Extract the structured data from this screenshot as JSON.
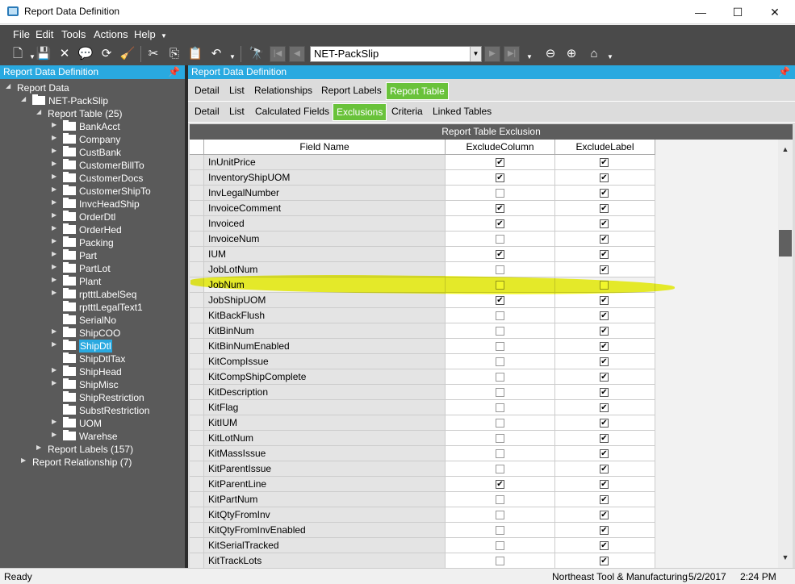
{
  "window": {
    "title": "Report Data Definition",
    "controls": [
      "—",
      "☐",
      "✕"
    ]
  },
  "menu": [
    "File",
    "Edit",
    "Tools",
    "Actions",
    "Help"
  ],
  "toolbar": {
    "record": "NET-PackSlip"
  },
  "left_panel": {
    "title": "Report Data Definition",
    "tree": [
      {
        "label": "Report Data",
        "level": 0,
        "twist": "open",
        "folder": false
      },
      {
        "label": "NET-PackSlip",
        "level": 1,
        "twist": "open",
        "folder": true
      },
      {
        "label": "Report Table (25)",
        "level": 2,
        "twist": "open",
        "folder": false
      },
      {
        "label": "BankAcct",
        "level": 3,
        "twist": "closed",
        "folder": true
      },
      {
        "label": "Company",
        "level": 3,
        "twist": "closed",
        "folder": true
      },
      {
        "label": "CustBank",
        "level": 3,
        "twist": "closed",
        "folder": true
      },
      {
        "label": "CustomerBillTo",
        "level": 3,
        "twist": "closed",
        "folder": true
      },
      {
        "label": "CustomerDocs",
        "level": 3,
        "twist": "closed",
        "folder": true
      },
      {
        "label": "CustomerShipTo",
        "level": 3,
        "twist": "closed",
        "folder": true
      },
      {
        "label": "InvcHeadShip",
        "level": 3,
        "twist": "closed",
        "folder": true
      },
      {
        "label": "OrderDtl",
        "level": 3,
        "twist": "closed",
        "folder": true
      },
      {
        "label": "OrderHed",
        "level": 3,
        "twist": "closed",
        "folder": true
      },
      {
        "label": "Packing",
        "level": 3,
        "twist": "closed",
        "folder": true
      },
      {
        "label": "Part",
        "level": 3,
        "twist": "closed",
        "folder": true
      },
      {
        "label": "PartLot",
        "level": 3,
        "twist": "closed",
        "folder": true
      },
      {
        "label": "Plant",
        "level": 3,
        "twist": "closed",
        "folder": true
      },
      {
        "label": "rptttLabelSeq",
        "level": 3,
        "twist": "closed",
        "folder": true
      },
      {
        "label": "rptttLegalText1",
        "level": 3,
        "twist": "none",
        "folder": true
      },
      {
        "label": "SerialNo",
        "level": 3,
        "twist": "none",
        "folder": true
      },
      {
        "label": "ShipCOO",
        "level": 3,
        "twist": "closed",
        "folder": true
      },
      {
        "label": "ShipDtl",
        "level": 3,
        "twist": "closed",
        "folder": true,
        "selected": true
      },
      {
        "label": "ShipDtlTax",
        "level": 3,
        "twist": "none",
        "folder": true
      },
      {
        "label": "ShipHead",
        "level": 3,
        "twist": "closed",
        "folder": true
      },
      {
        "label": "ShipMisc",
        "level": 3,
        "twist": "closed",
        "folder": true
      },
      {
        "label": "ShipRestriction",
        "level": 3,
        "twist": "none",
        "folder": true
      },
      {
        "label": "SubstRestriction",
        "level": 3,
        "twist": "none",
        "folder": true
      },
      {
        "label": "UOM",
        "level": 3,
        "twist": "closed",
        "folder": true
      },
      {
        "label": "Warehse",
        "level": 3,
        "twist": "closed",
        "folder": true
      },
      {
        "label": "Report Labels (157)",
        "level": 2,
        "twist": "closed",
        "folder": false
      },
      {
        "label": "Report Relationship (7)",
        "level": 1,
        "twist": "closed",
        "folder": false
      }
    ]
  },
  "right_panel": {
    "title": "Report Data Definition",
    "tabs_top": [
      {
        "label": "Detail",
        "active": false
      },
      {
        "label": "List",
        "active": false
      },
      {
        "label": "Relationships",
        "active": false
      },
      {
        "label": "Report Labels",
        "active": false
      },
      {
        "label": "Report Table",
        "active": true
      }
    ],
    "tabs_sub": [
      {
        "label": "Detail",
        "active": false
      },
      {
        "label": "List",
        "active": false
      },
      {
        "label": "Calculated Fields",
        "active": false
      },
      {
        "label": "Exclusions",
        "active": true
      },
      {
        "label": "Criteria",
        "active": false
      },
      {
        "label": "Linked Tables",
        "active": false
      }
    ],
    "grid": {
      "caption": "Report Table Exclusion",
      "columns": [
        "Field Name",
        "ExcludeColumn",
        "ExcludeLabel"
      ],
      "rows": [
        {
          "field": "InUnitPrice",
          "exclude_column": true,
          "exclude_label": true
        },
        {
          "field": "InventoryShipUOM",
          "exclude_column": true,
          "exclude_label": true
        },
        {
          "field": "InvLegalNumber",
          "exclude_column": false,
          "exclude_label": true
        },
        {
          "field": "InvoiceComment",
          "exclude_column": true,
          "exclude_label": true
        },
        {
          "field": "Invoiced",
          "exclude_column": true,
          "exclude_label": true
        },
        {
          "field": "InvoiceNum",
          "exclude_column": false,
          "exclude_label": true
        },
        {
          "field": "IUM",
          "exclude_column": true,
          "exclude_label": true
        },
        {
          "field": "JobLotNum",
          "exclude_column": false,
          "exclude_label": true
        },
        {
          "field": "JobNum",
          "exclude_column": false,
          "exclude_label": false,
          "highlighted": true
        },
        {
          "field": "JobShipUOM",
          "exclude_column": true,
          "exclude_label": true
        },
        {
          "field": "KitBackFlush",
          "exclude_column": false,
          "exclude_label": true
        },
        {
          "field": "KitBinNum",
          "exclude_column": false,
          "exclude_label": true
        },
        {
          "field": "KitBinNumEnabled",
          "exclude_column": false,
          "exclude_label": true
        },
        {
          "field": "KitCompIssue",
          "exclude_column": false,
          "exclude_label": true
        },
        {
          "field": "KitCompShipComplete",
          "exclude_column": false,
          "exclude_label": true
        },
        {
          "field": "KitDescription",
          "exclude_column": false,
          "exclude_label": true
        },
        {
          "field": "KitFlag",
          "exclude_column": false,
          "exclude_label": true
        },
        {
          "field": "KitIUM",
          "exclude_column": false,
          "exclude_label": true
        },
        {
          "field": "KitLotNum",
          "exclude_column": false,
          "exclude_label": true
        },
        {
          "field": "KitMassIssue",
          "exclude_column": false,
          "exclude_label": true
        },
        {
          "field": "KitParentIssue",
          "exclude_column": false,
          "exclude_label": true
        },
        {
          "field": "KitParentLine",
          "exclude_column": true,
          "exclude_label": true
        },
        {
          "field": "KitPartNum",
          "exclude_column": false,
          "exclude_label": true
        },
        {
          "field": "KitQtyFromInv",
          "exclude_column": false,
          "exclude_label": true
        },
        {
          "field": "KitQtyFromInvEnabled",
          "exclude_column": false,
          "exclude_label": true
        },
        {
          "field": "KitSerialTracked",
          "exclude_column": false,
          "exclude_label": true
        },
        {
          "field": "KitTrackLots",
          "exclude_column": false,
          "exclude_label": true
        }
      ]
    }
  },
  "status": {
    "left": "Ready",
    "company": "Northeast Tool & Manufacturing",
    "date": "5/2/2017",
    "time": "2:24 PM"
  },
  "colors": {
    "accent": "#29a9e0",
    "active_tab": "#69c23a",
    "dark_panel": "#5a5a5a",
    "highlight": "#f0f514"
  }
}
